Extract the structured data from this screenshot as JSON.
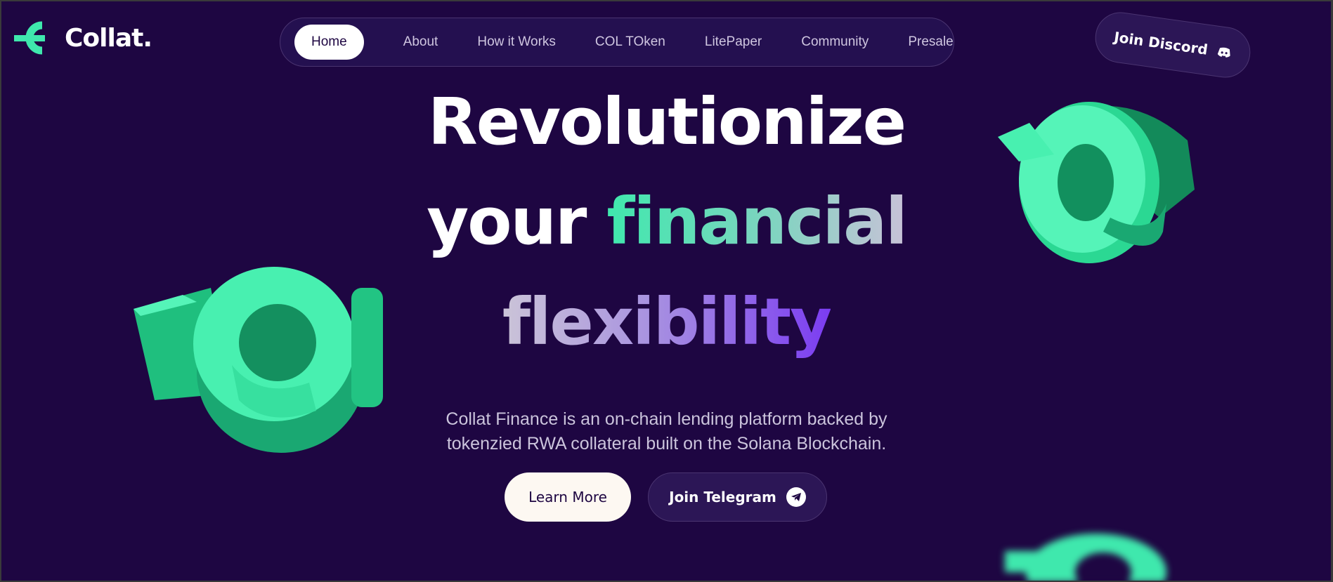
{
  "brand": {
    "name": "Collat.",
    "accent": "#3fe8ad",
    "background": "#1e0642",
    "purple_accent": "#7b3cf2"
  },
  "nav": {
    "items": [
      {
        "label": "Home",
        "active": true
      },
      {
        "label": "About"
      },
      {
        "label": "How it Works"
      },
      {
        "label": "COL TOken"
      },
      {
        "label": "LitePaper"
      },
      {
        "label": "Community"
      },
      {
        "label": "Presale"
      }
    ]
  },
  "discord": {
    "label": "Join Discord",
    "icon": "discord-icon"
  },
  "hero": {
    "line1": "Revolutionize",
    "line2_a": "your",
    "line2_b": "financial",
    "line3": "flexibility",
    "description_1": "Collat Finance is an on-chain lending platform backed by",
    "description_2": "tokenzied RWA collateral built on the Solana Blockchain.",
    "learn_more": "Learn More",
    "telegram": "Join Telegram",
    "telegram_icon": "telegram-icon"
  },
  "decorations": [
    "collat-3d-logo-left",
    "collat-3d-logo-right",
    "collat-3d-logo-blurred"
  ]
}
